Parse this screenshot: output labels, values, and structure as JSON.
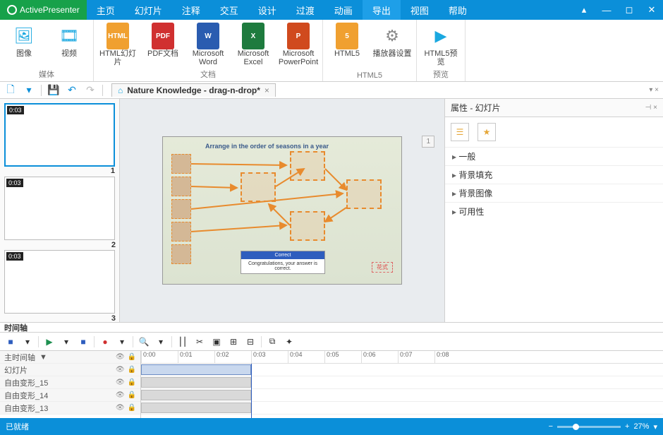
{
  "app": {
    "name": "ActivePresenter"
  },
  "menu": [
    "主页",
    "幻灯片",
    "注释",
    "交互",
    "设计",
    "过渡",
    "动画",
    "导出",
    "视图",
    "帮助"
  ],
  "menu_active": 7,
  "ribbon": {
    "groups": [
      {
        "name": "媒体",
        "items": [
          {
            "label": "图像",
            "icon": "🖼",
            "color": "#1aa8e0"
          },
          {
            "label": "视频",
            "icon": "🎞",
            "color": "#1aa8e0"
          }
        ]
      },
      {
        "name": "文档",
        "items": [
          {
            "label": "HTML幻灯片",
            "icon": "HTML",
            "color": "#f0a030"
          },
          {
            "label": "PDF文档",
            "icon": "PDF",
            "color": "#d03030"
          },
          {
            "label": "Microsoft Word",
            "icon": "W",
            "color": "#2a5cb0"
          },
          {
            "label": "Microsoft Excel",
            "icon": "X",
            "color": "#1e7b3e"
          },
          {
            "label": "Microsoft PowerPoint",
            "icon": "P",
            "color": "#d04a1e"
          }
        ]
      },
      {
        "name": "HTML5",
        "items": [
          {
            "label": "HTML5",
            "icon": "5",
            "color": "#f0a030"
          },
          {
            "label": "播放器设置",
            "icon": "⚙",
            "color": "#888"
          }
        ]
      },
      {
        "name": "预览",
        "items": [
          {
            "label": "HTML5预览",
            "icon": "▶",
            "color": "#1aa8e0"
          }
        ]
      }
    ]
  },
  "doc_title": "Nature Knowledge - drag-n-drop*",
  "thumbs": [
    {
      "ts": "0:03",
      "n": "1",
      "sel": true
    },
    {
      "ts": "0:03",
      "n": "2",
      "sel": false
    },
    {
      "ts": "0:03",
      "n": "3",
      "sel": false
    }
  ],
  "canvas": {
    "title": "Arrange in the order of seasons in a year",
    "dialog_hdr": "Correct",
    "dialog_body": "Congratulations, your answer is correct.",
    "page": "1"
  },
  "props": {
    "title": "属性 - 幻灯片",
    "sections": [
      "一般",
      "背景填充",
      "背景图像",
      "可用性"
    ]
  },
  "timeline": {
    "title": "时间轴",
    "main_track": "主时间轴",
    "rows": [
      "幻灯片",
      "自由变形_15",
      "自由变形_14",
      "自由变形_13"
    ],
    "ticks": [
      "0:00",
      "0:01",
      "0:02",
      "0:03",
      "0:04",
      "0:05",
      "0:06",
      "0:07",
      "0:08"
    ]
  },
  "status": {
    "text": "已就绪",
    "zoom": "27%"
  }
}
